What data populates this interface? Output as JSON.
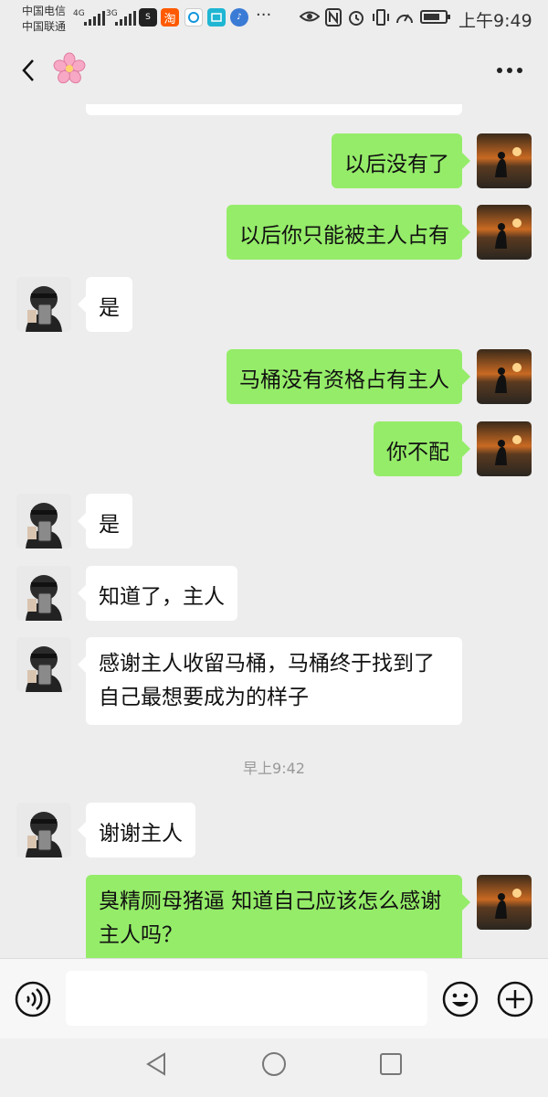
{
  "status_bar": {
    "carrier_1": "中国电信",
    "carrier_2": "中国联通",
    "net_1": "4G",
    "net_2": "3G",
    "time": "上午9:49",
    "battery_level": 0.75,
    "icons": [
      "soul-app-icon",
      "taobao-app-icon",
      "qq-app-icon",
      "reader-app-icon",
      "music-app-icon",
      "eye-icon",
      "nfc-icon",
      "alarm-icon",
      "vibrate-icon",
      "speed-icon",
      "battery-icon"
    ]
  },
  "header": {
    "contact_icon": "cherry-blossom-emoji",
    "back_icon": "back-chevron-icon",
    "more_icon": "more-dots-icon"
  },
  "colors": {
    "background": "#ededed",
    "sent_bubble": "#95ec69",
    "received_bubble": "#ffffff",
    "timestamp": "#999999"
  },
  "messages": [
    {
      "side": "right",
      "text": "以后没有了"
    },
    {
      "side": "right",
      "text": "以后你只能被主人占有"
    },
    {
      "side": "left",
      "text": "是"
    },
    {
      "side": "right",
      "text": "马桶没有资格占有主人"
    },
    {
      "side": "right",
      "text": "你不配"
    },
    {
      "side": "left",
      "text": "是"
    },
    {
      "side": "left",
      "text": "知道了，主人"
    },
    {
      "side": "left",
      "text": "感谢主人收留马桶，马桶终于找到了自己最想要成为的样子"
    },
    {
      "side": "left",
      "text": "谢谢主人"
    },
    {
      "side": "right",
      "text": "臭精厕母猪逼 知道自己应该怎么感谢主人吗？"
    }
  ],
  "timestamp": "早上9:42",
  "input": {
    "placeholder": "",
    "voice_icon": "voice-icon",
    "emoji_icon": "emoji-icon",
    "plus_icon": "plus-icon"
  },
  "navbar": {
    "icons": [
      "nav-back-icon",
      "nav-home-icon",
      "nav-recent-icon"
    ]
  }
}
